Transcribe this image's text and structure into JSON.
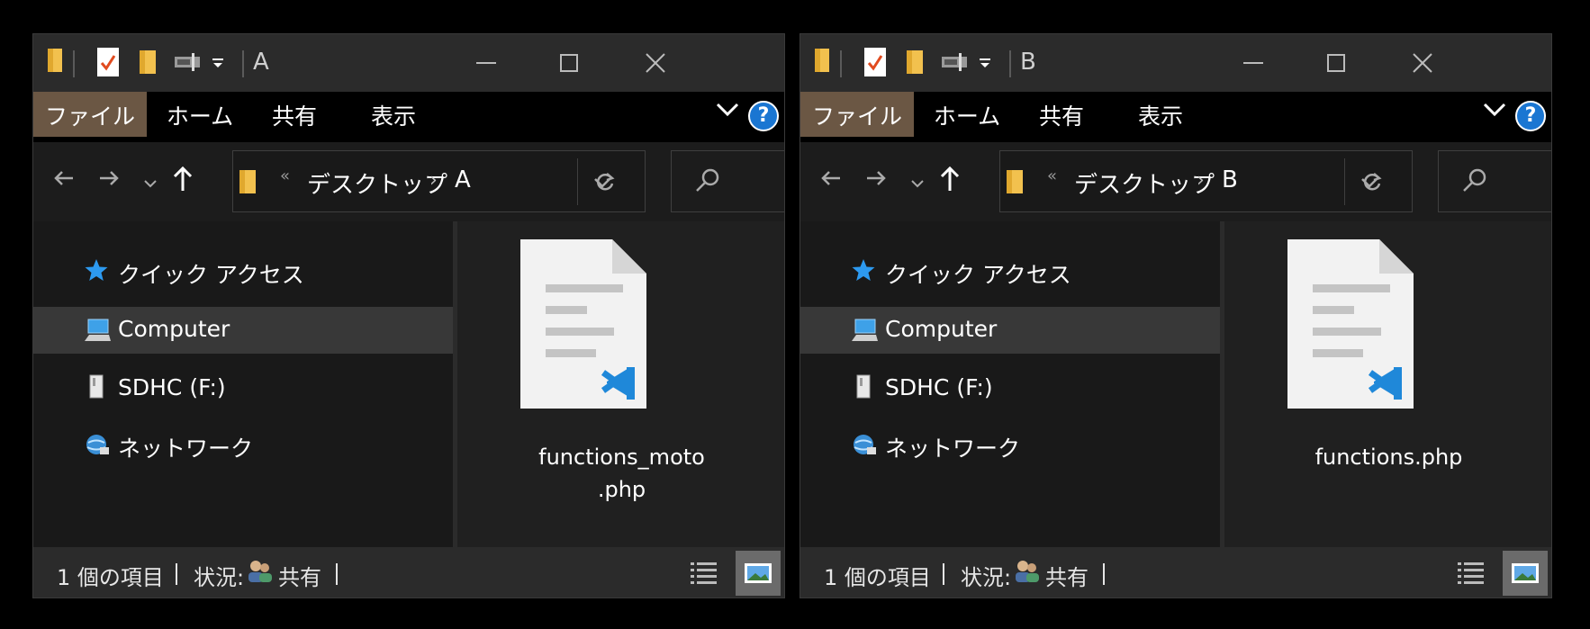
{
  "windows": [
    {
      "title": "A",
      "ribbon_tabs": [
        "ファイル",
        "ホーム",
        "共有",
        "表示"
      ],
      "help": "?",
      "address": {
        "prefix": "«",
        "segment1": "デスクトップ",
        "separator": "›",
        "segment2": "A"
      },
      "nav_items": [
        {
          "label": "クイック アクセス",
          "icon": "star-icon"
        },
        {
          "label": "Computer",
          "icon": "computer-icon",
          "selected": true
        },
        {
          "label": "SDHC (F:)",
          "icon": "drive-icon"
        },
        {
          "label": "ネットワーク",
          "icon": "network-icon"
        }
      ],
      "file": {
        "name_line1": "functions_moto",
        "name_line2": ".php",
        "icon": "vscode-php-file-icon"
      },
      "status": {
        "count": "1 個の項目",
        "state_label": "状況:",
        "state_value": "共有"
      }
    },
    {
      "title": "B",
      "ribbon_tabs": [
        "ファイル",
        "ホーム",
        "共有",
        "表示"
      ],
      "help": "?",
      "address": {
        "prefix": "«",
        "segment1": "デスクトップ",
        "separator": "›",
        "segment2": "B"
      },
      "nav_items": [
        {
          "label": "クイック アクセス",
          "icon": "star-icon"
        },
        {
          "label": "Computer",
          "icon": "computer-icon",
          "selected": true
        },
        {
          "label": "SDHC (F:)",
          "icon": "drive-icon"
        },
        {
          "label": "ネットワーク",
          "icon": "network-icon"
        }
      ],
      "file": {
        "name_line1": "functions.php",
        "name_line2": "",
        "icon": "vscode-php-file-icon"
      },
      "status": {
        "count": "1 個の項目",
        "state_label": "状況:",
        "state_value": "共有"
      }
    }
  ],
  "colors": {
    "file_tab": "#6b5744",
    "help_blue": "#1a76d2",
    "vscode_blue": "#1f88d9",
    "selected_row": "#383838"
  }
}
